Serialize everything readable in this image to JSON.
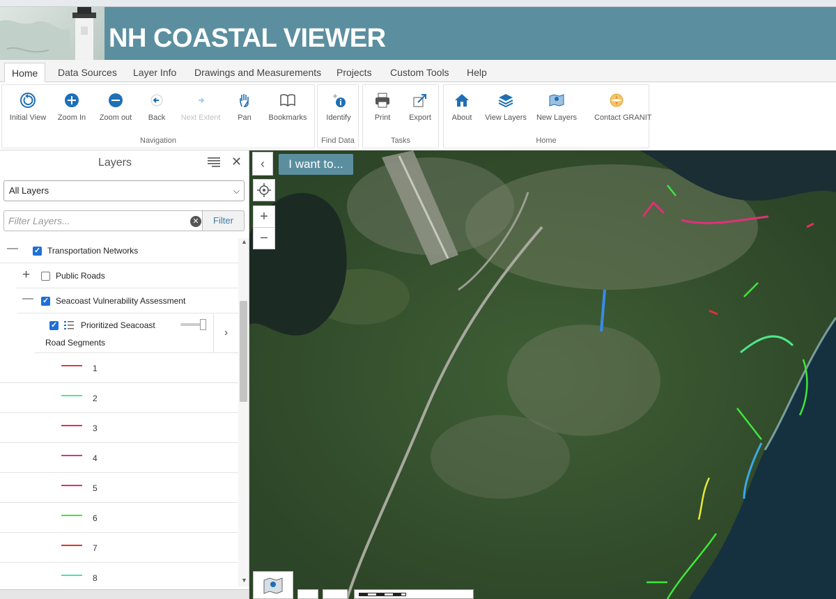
{
  "app": {
    "title": "NH COASTAL VIEWER"
  },
  "tabs": [
    {
      "label": "Home",
      "active": true
    },
    {
      "label": "Data Sources"
    },
    {
      "label": "Layer Info"
    },
    {
      "label": "Drawings and Measurements"
    },
    {
      "label": "Projects"
    },
    {
      "label": "Custom Tools"
    },
    {
      "label": "Help"
    }
  ],
  "ribbon": {
    "groups": {
      "navigation": "Navigation",
      "find_data": "Find Data",
      "tasks": "Tasks",
      "home": "Home"
    },
    "buttons": {
      "initial_view": "Initial View",
      "zoom_in": "Zoom In",
      "zoom_out": "Zoom out",
      "back": "Back",
      "next_extent": "Next Extent",
      "pan": "Pan",
      "bookmarks": "Bookmarks",
      "identify": "Identify",
      "print": "Print",
      "export": "Export",
      "about": "About",
      "view_layers": "View Layers",
      "new_layers": "New Layers",
      "contact_granit": "Contact GRANIT"
    },
    "accent": "#1e6fb5"
  },
  "layers_panel": {
    "title": "Layers",
    "close": "✕",
    "select_value": "All Layers",
    "filter_placeholder": "Filter Layers...",
    "filter_button": "Filter",
    "tree": {
      "transportation": "Transportation Networks",
      "public_roads": "Public Roads",
      "seacoast": "Seacoast Vulnerability Assessment",
      "prioritized_line1": "Prioritized Seacoast",
      "prioritized_line2": "Road Segments"
    },
    "legend": [
      {
        "label": "1",
        "color": "#e0383e"
      },
      {
        "label": "2",
        "color": "#4ee88a"
      },
      {
        "label": "3",
        "color": "#e0305a"
      },
      {
        "label": "4",
        "color": "#e0307a"
      },
      {
        "label": "5",
        "color": "#e03068"
      },
      {
        "label": "6",
        "color": "#3ee83a"
      },
      {
        "label": "7",
        "color": "#e03030"
      },
      {
        "label": "8",
        "color": "#3ee8a8"
      }
    ]
  },
  "map": {
    "i_want_to": "I want to..."
  }
}
